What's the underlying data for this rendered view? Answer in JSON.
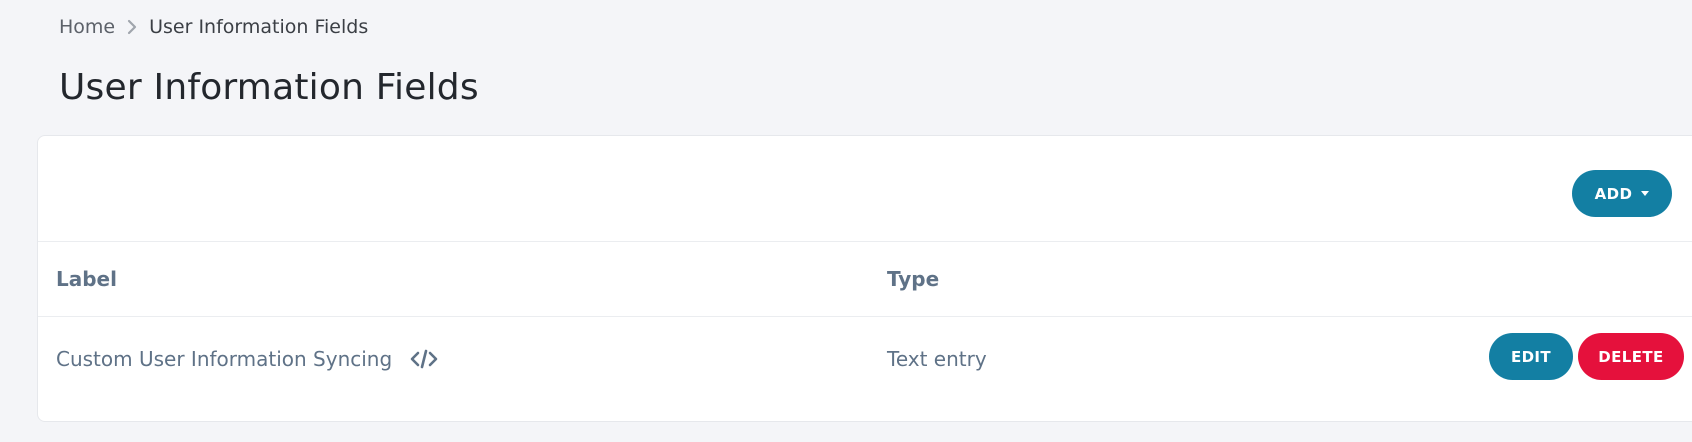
{
  "breadcrumb": {
    "home": "Home",
    "current": "User Information Fields"
  },
  "page": {
    "title": "User Information Fields"
  },
  "toolbar": {
    "add_label": "ADD"
  },
  "table": {
    "columns": [
      "Label",
      "Type"
    ],
    "rows": [
      {
        "label": "Custom User Information Syncing",
        "type": "Text entry",
        "edit_label": "EDIT",
        "delete_label": "DELETE"
      }
    ]
  },
  "icons": {
    "breadcrumb_separator": "chevron-right-icon",
    "row_label_icon": "code-icon",
    "add_dropdown": "caret-down-icon"
  },
  "colors": {
    "primary": "#137fa3",
    "danger": "#e5113c",
    "background": "#f4f5f8",
    "muted_text": "#5f7287"
  }
}
